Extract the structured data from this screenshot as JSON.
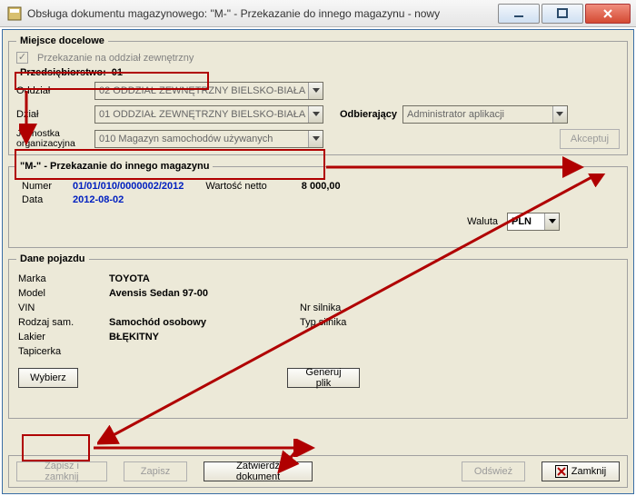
{
  "window": {
    "title": "Obsługa dokumentu magazynowego:  \"M-\" - Przekazanie do innego magazynu  - nowy"
  },
  "dest": {
    "legend": "Miejsce docelowe",
    "external_checkbox_label": "Przekazanie na oddział zewnętrzny",
    "enterprise_label": "Przedsiębiorstwo:",
    "enterprise_value": "01",
    "branch_label": "Oddział",
    "branch_value": "02 ODDZIAŁ ZEWNĘTRZNY BIELSKO-BIAŁA",
    "dept_label": "Dział",
    "dept_value": "01 ODDZIAŁ ZEWNĘTRZNY BIELSKO-BIAŁA",
    "recipient_label": "Odbierający",
    "recipient_value": "Administrator aplikacji",
    "orgunit_label": "Jednostka\norganizacyjna",
    "orgunit_value": "010 Magazyn samochodów używanych",
    "accept_btn": "Akceptuj"
  },
  "doc": {
    "legend": "\"M-\" - Przekazanie do innego magazynu",
    "number_label": "Numer",
    "number_value": "01/01/010/0000002/2012",
    "netvalue_label": "Wartość netto",
    "netvalue_value": "8 000,00",
    "date_label": "Data",
    "date_value": "2012-08-02",
    "currency_label": "Waluta",
    "currency_value": "PLN"
  },
  "vehicle": {
    "legend": "Dane pojazdu",
    "make_label": "Marka",
    "make_value": "TOYOTA",
    "model_label": "Model",
    "model_value": "Avensis Sedan 97-00",
    "vin_label": "VIN",
    "vin_value": "",
    "engine_no_label": "Nr silnika",
    "engine_no_value": "",
    "type_label": "Rodzaj sam.",
    "type_value": "Samochód osobowy",
    "engine_type_label": "Typ silnika",
    "engine_type_value": "",
    "paint_label": "Lakier",
    "paint_value": "BŁĘKITNY",
    "upholstery_label": "Tapicerka",
    "upholstery_value": "",
    "choose_btn": "Wybierz",
    "generate_btn": "Generuj plik"
  },
  "buttons": {
    "save_close": "Zapisz i zamknij",
    "save": "Zapisz",
    "approve_doc": "Zatwierdź dokument",
    "refresh": "Odśwież",
    "close": "Zamknij"
  },
  "icons": {
    "app": "app-icon"
  }
}
